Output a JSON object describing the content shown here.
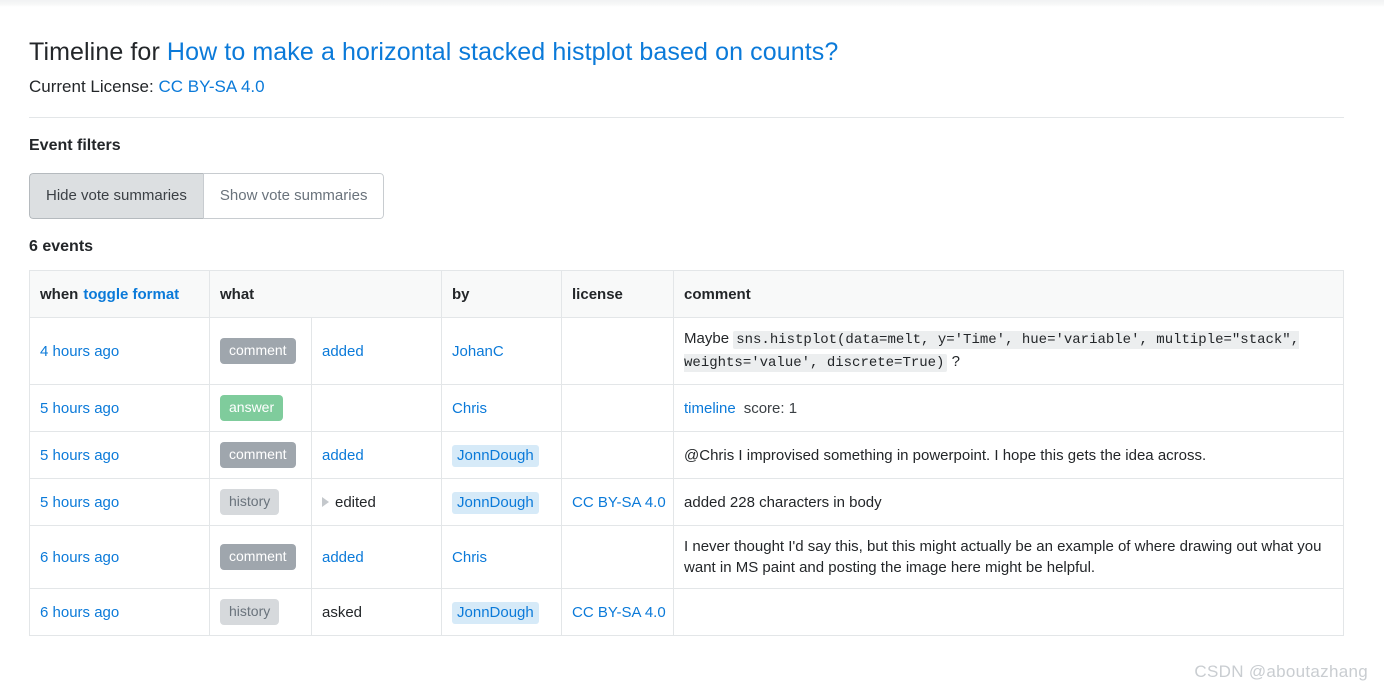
{
  "header": {
    "title_prefix": "Timeline for ",
    "question_title": "How to make a horizontal stacked histplot based on counts?",
    "license_label": "Current License: ",
    "license_value": "CC BY-SA 4.0"
  },
  "filters": {
    "heading": "Event filters",
    "hide_votes_label": "Hide vote summaries",
    "show_votes_label": "Show vote summaries",
    "selected": "Hide vote summaries",
    "event_count": "6 events"
  },
  "table": {
    "headers": {
      "when": "when",
      "toggle_format": "toggle format",
      "what": "what",
      "by": "by",
      "license": "license",
      "comment": "comment"
    },
    "rows": [
      {
        "when": "4 hours ago",
        "badge": "comment",
        "badge_type": "comment",
        "action": "added",
        "action_link": true,
        "has_caret": false,
        "by": "JohanC",
        "by_highlighted": false,
        "license": "",
        "comment_prefix": "Maybe ",
        "comment_code": "sns.histplot(data=melt, y='Time', hue='variable', multiple=\"stack\", weights='value', discrete=True)",
        "comment_suffix": " ?",
        "comment_text": "",
        "timeline_link": "",
        "score": ""
      },
      {
        "when": "5 hours ago",
        "badge": "answer",
        "badge_type": "answer",
        "action": "",
        "action_link": false,
        "has_caret": false,
        "by": "Chris",
        "by_highlighted": false,
        "license": "",
        "comment_prefix": "",
        "comment_code": "",
        "comment_suffix": "",
        "comment_text": "",
        "timeline_link": "timeline",
        "score": "score: 1"
      },
      {
        "when": "5 hours ago",
        "badge": "comment",
        "badge_type": "comment",
        "action": "added",
        "action_link": true,
        "has_caret": false,
        "by": "JonnDough",
        "by_highlighted": true,
        "license": "",
        "comment_prefix": "",
        "comment_code": "",
        "comment_suffix": "",
        "comment_text": "@Chris I improvised something in powerpoint. I hope this gets the idea across.",
        "timeline_link": "",
        "score": ""
      },
      {
        "when": "5 hours ago",
        "badge": "history",
        "badge_type": "history",
        "action": "edited",
        "action_link": false,
        "has_caret": true,
        "by": "JonnDough",
        "by_highlighted": true,
        "license": "CC BY-SA 4.0",
        "comment_prefix": "",
        "comment_code": "",
        "comment_suffix": "",
        "comment_text": "added 228 characters in body",
        "timeline_link": "",
        "score": ""
      },
      {
        "when": "6 hours ago",
        "badge": "comment",
        "badge_type": "comment",
        "action": "added",
        "action_link": true,
        "has_caret": false,
        "by": "Chris",
        "by_highlighted": false,
        "license": "",
        "comment_prefix": "",
        "comment_code": "",
        "comment_suffix": "",
        "comment_text": "I never thought I'd say this, but this might actually be an example of where drawing out what you want in MS paint and posting the image here might be helpful.",
        "timeline_link": "",
        "score": ""
      },
      {
        "when": "6 hours ago",
        "badge": "history",
        "badge_type": "history",
        "action": "asked",
        "action_link": false,
        "has_caret": false,
        "by": "JonnDough",
        "by_highlighted": true,
        "license": "CC BY-SA 4.0",
        "comment_prefix": "",
        "comment_code": "",
        "comment_suffix": "",
        "comment_text": "",
        "timeline_link": "",
        "score": ""
      }
    ]
  },
  "watermark": "CSDN @aboutazhang",
  "colors": {
    "link": "#0b7ad9",
    "badge_comment": "#9fa6ad",
    "badge_answer": "#7fcc9c",
    "badge_history": "#d6d9dc",
    "user_highlight": "#d6eaf8",
    "code_bg": "#eceeef",
    "border": "#e3e6e8"
  }
}
